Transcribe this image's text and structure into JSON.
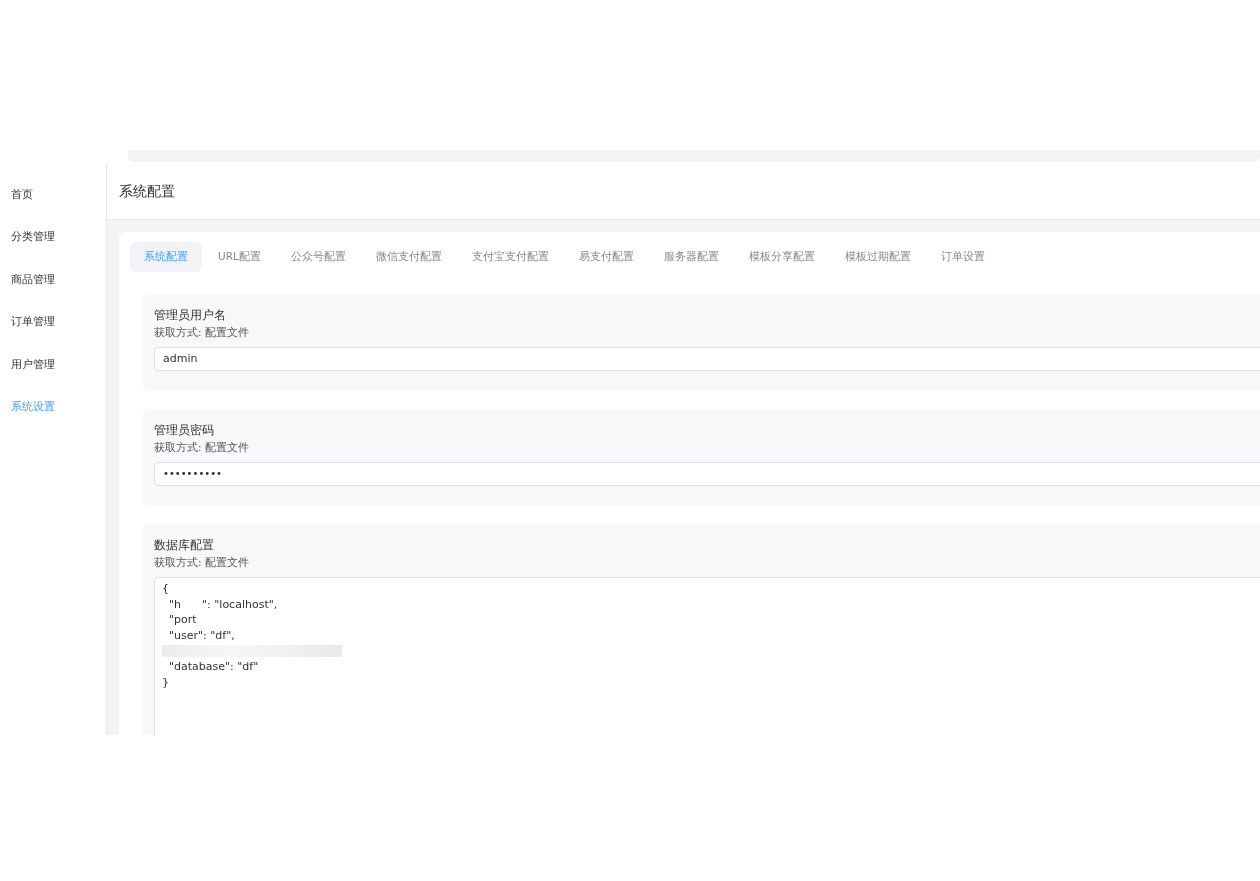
{
  "sidebar": {
    "items": [
      {
        "label": "首页",
        "selected": false
      },
      {
        "label": "分类管理",
        "selected": false
      },
      {
        "label": "商品管理",
        "selected": false
      },
      {
        "label": "订单管理",
        "selected": false
      },
      {
        "label": "用户管理",
        "selected": false
      },
      {
        "label": "系统设置",
        "selected": true
      }
    ]
  },
  "page_title": "系统配置",
  "tabs": [
    {
      "label": "系统配置",
      "selected": true
    },
    {
      "label": "URL配置",
      "selected": false
    },
    {
      "label": "公众号配置",
      "selected": false
    },
    {
      "label": "微信支付配置",
      "selected": false
    },
    {
      "label": "支付宝支付配置",
      "selected": false
    },
    {
      "label": "易支付配置",
      "selected": false
    },
    {
      "label": "服务器配置",
      "selected": false
    },
    {
      "label": "模板分享配置",
      "selected": false
    },
    {
      "label": "模板过期配置",
      "selected": false
    },
    {
      "label": "订单设置",
      "selected": false
    }
  ],
  "settings": [
    {
      "kind": "text",
      "label": "管理员用户名",
      "source": "获取方式: 配置文件",
      "value": "admin"
    },
    {
      "kind": "password",
      "label": "管理员密码",
      "source": "获取方式: 配置文件",
      "value": "••••••••••"
    },
    {
      "kind": "code",
      "label": "数据库配置",
      "source": "获取方式: 配置文件",
      "lines": [
        {
          "kind": "text",
          "text": "{"
        },
        {
          "kind": "text",
          "text": "  \"h      \": \"localhost\","
        },
        {
          "kind": "text",
          "text": "  \"port"
        },
        {
          "kind": "text",
          "text": "  \"user\": \"df\","
        },
        {
          "kind": "blurred"
        },
        {
          "kind": "text",
          "text": "  \"database\": \"df\""
        },
        {
          "kind": "text",
          "text": "}"
        }
      ]
    }
  ]
}
